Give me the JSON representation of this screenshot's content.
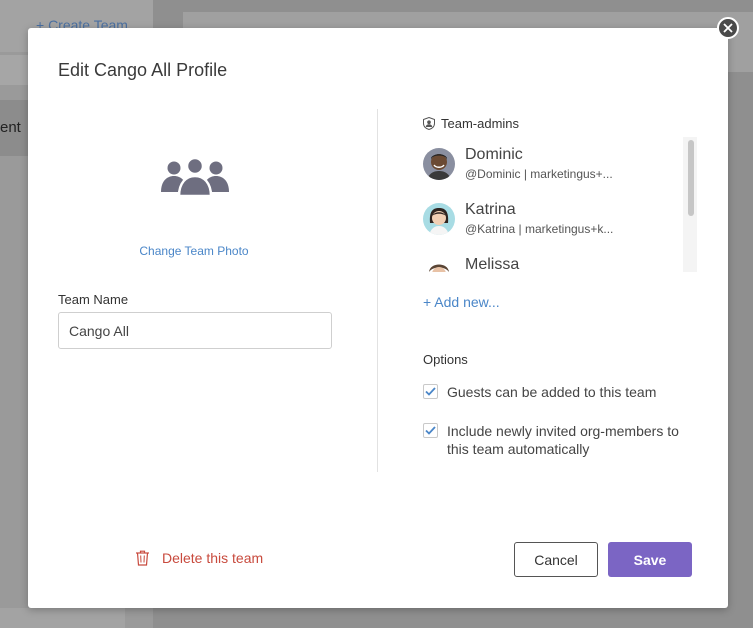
{
  "background": {
    "create_team_label": "+ Create Team",
    "list_item_fragment": "ent"
  },
  "modal": {
    "title": "Edit Cango All Profile",
    "change_photo_label": "Change Team Photo",
    "team_name_label": "Team Name",
    "team_name_value": "Cango All",
    "admins_header": "Team-admins",
    "admins": [
      {
        "name": "Dominic",
        "sub": "@Dominic | marketingus+..."
      },
      {
        "name": "Katrina",
        "sub": "@Katrina | marketingus+k..."
      },
      {
        "name": "Melissa",
        "sub": ""
      }
    ],
    "add_new_label": "+ Add new...",
    "options_label": "Options",
    "options": [
      {
        "label": "Guests can be added to this team",
        "checked": true
      },
      {
        "label_line1": "Include newly invited org-members to",
        "label_line2": "this team automatically",
        "checked": true
      }
    ],
    "delete_label": "Delete this team",
    "cancel_label": "Cancel",
    "save_label": "Save"
  },
  "colors": {
    "accent": "#7b65c4",
    "link": "#4a86c8",
    "danger": "#c84a3d",
    "overlay": "#8f8f8f"
  },
  "icons": {
    "close": "close-icon",
    "team": "team-group-icon",
    "admin": "shield-user-icon",
    "check": "checkmark-icon",
    "trash": "trash-icon"
  }
}
